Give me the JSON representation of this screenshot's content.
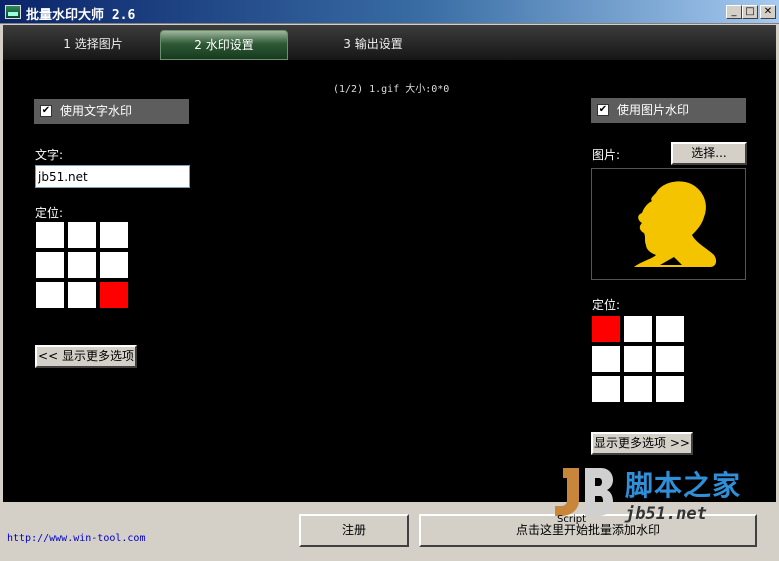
{
  "window": {
    "title": "批量水印大师 2.6",
    "buttons": [
      "0",
      "1",
      "r"
    ]
  },
  "tabs": [
    {
      "label": "1 选择图片"
    },
    {
      "label": "2 水印设置"
    },
    {
      "label": "3 输出设置"
    }
  ],
  "file_info": "(1/2)  1.gif 大小:0*0",
  "text_watermark": {
    "enabled_label": "使用文字水印",
    "text_label": "文字:",
    "text_value": "jb51.net",
    "position_label": "定位:",
    "selected_cell": 8,
    "more_button": "<< 显示更多选项"
  },
  "image_watermark": {
    "enabled_label": "使用图片水印",
    "image_label": "图片:",
    "choose_button": "选择...",
    "position_label": "定位:",
    "selected_cell": 0,
    "more_button": "显示更多选项 >>"
  },
  "footer": {
    "url": "http://www.win-tool.com",
    "register_button": "注册",
    "apply_button": "点击这里开始批量添加水印"
  },
  "watermark_overlay": {
    "site": "脚本之家",
    "url": "jb51.net",
    "script": "Script"
  },
  "colors": {
    "accent_selected": "#ff0000",
    "silhouette": "#f5c400",
    "titlebar": "#0a246a"
  }
}
